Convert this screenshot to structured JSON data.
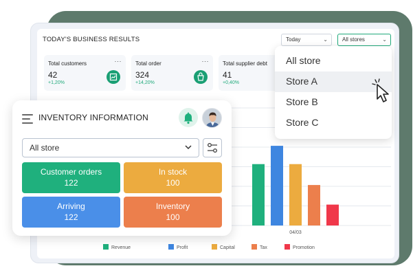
{
  "dashboard": {
    "title": "TODAY'S BUSINESS RESULTS",
    "date_select": "Today",
    "store_select": "All stores",
    "kpis": [
      {
        "label": "Total customers",
        "value": "42",
        "change": "+1,20%"
      },
      {
        "label": "Total order",
        "value": "324",
        "change": "+14,20%"
      },
      {
        "label": "Total supplier debt",
        "value": "41",
        "change": "+0,40%"
      }
    ],
    "kpi_menu": "···"
  },
  "store_dropdown": {
    "options": [
      "All store",
      "Store A",
      "Store B",
      "Store C"
    ],
    "hovered": "Store A"
  },
  "inventory": {
    "title": "INVENTORY INFORMATION",
    "store_select": "All store",
    "tiles": [
      {
        "label": "Customer orders",
        "value": "122"
      },
      {
        "label": "In stock",
        "value": "100"
      },
      {
        "label": "Arriving",
        "value": "122"
      },
      {
        "label": "Inventory",
        "value": "100"
      }
    ]
  },
  "chart_data": {
    "type": "bar",
    "categories": [
      "04/03"
    ],
    "series": [
      {
        "name": "Revenue",
        "values": [
          47
        ]
      },
      {
        "name": "Profit",
        "values": [
          61
        ]
      },
      {
        "name": "Capital",
        "values": [
          47
        ]
      },
      {
        "name": "Tax",
        "values": [
          31
        ]
      },
      {
        "name": "Promotion",
        "values": [
          16
        ]
      }
    ],
    "ylim": [
      0,
      100
    ],
    "grid": true,
    "legend": "bottom"
  },
  "colors": {
    "accent": "#1a9f74",
    "revenue": "#1fb07d",
    "profit": "#3e86e0",
    "capital": "#ecab3f",
    "tax": "#ec7f4c",
    "promotion": "#f0384a"
  }
}
